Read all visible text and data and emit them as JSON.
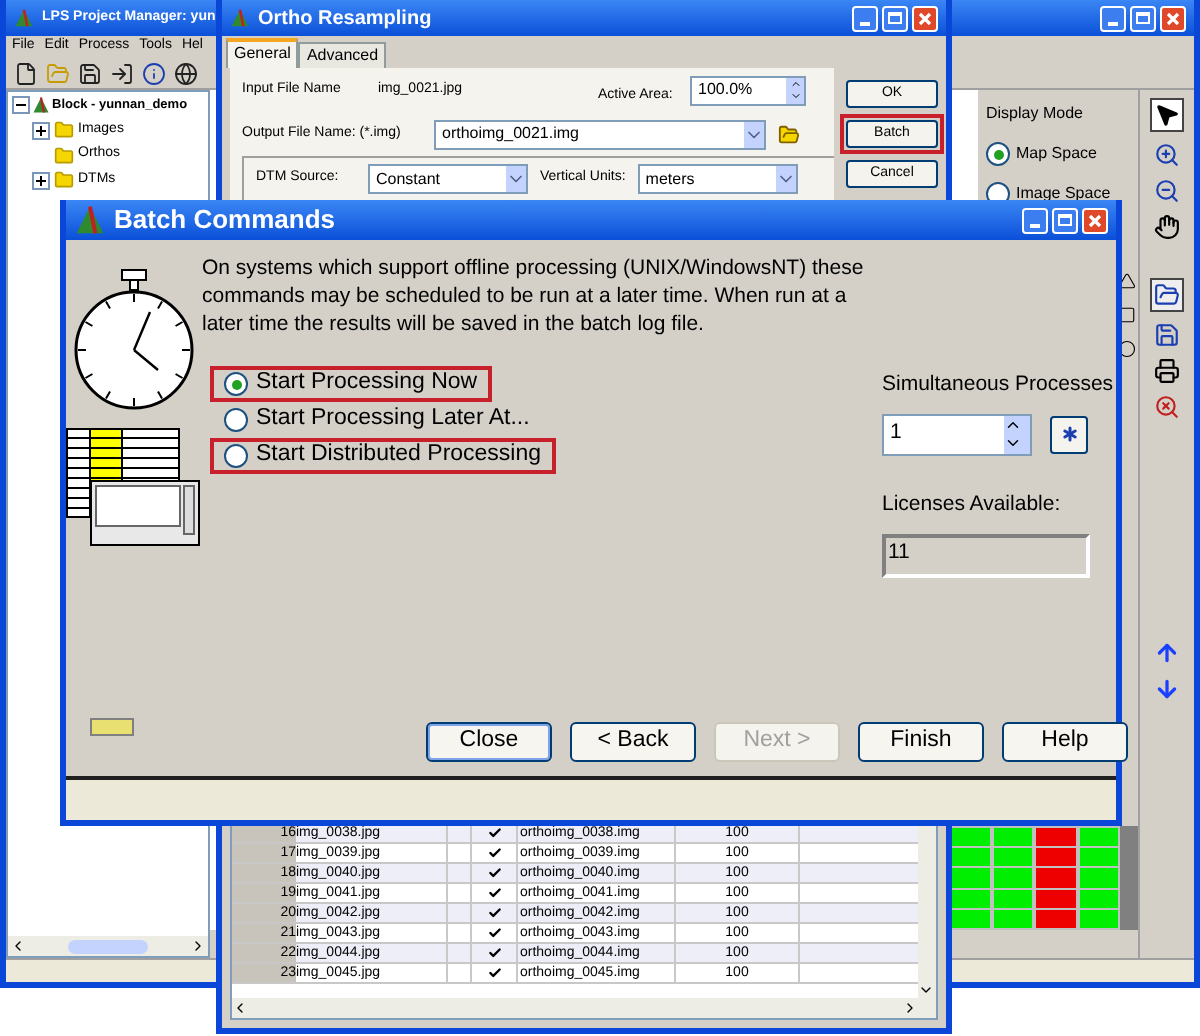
{
  "project_window": {
    "title": "LPS Project Manager: yun",
    "menu": [
      "File",
      "Edit",
      "Process",
      "Tools",
      "Hel"
    ],
    "tree": {
      "label": "Block - yunnan_demo",
      "expanded": true,
      "children": [
        {
          "label": "Images",
          "expanded": false
        },
        {
          "label": "Orthos"
        },
        {
          "label": "DTMs",
          "expanded": false
        }
      ]
    },
    "display_mode": {
      "title": "Display Mode",
      "options": [
        {
          "label": "Map Space",
          "selected": true
        },
        {
          "label": "Image Space",
          "selected": false
        }
      ]
    },
    "status_grid": {
      "columns": [
        {
          "color": "#00ee00"
        },
        {
          "color": "#00ee00"
        },
        {
          "color": "#ee0000"
        },
        {
          "color": "#00ee00"
        }
      ]
    }
  },
  "ortho_window": {
    "title": "Ortho Resampling",
    "tabs": [
      {
        "label": "General",
        "selected": true
      },
      {
        "label": "Advanced",
        "selected": false
      }
    ],
    "input_file": {
      "label": "Input File Name",
      "value": "img_0021.jpg"
    },
    "active_area": {
      "label": "Active Area:",
      "value": "100.0%"
    },
    "output_file": {
      "label": "Output File Name: (*.img)",
      "value": "orthoimg_0021.img"
    },
    "dtm_source": {
      "label": "DTM Source:",
      "value": "Constant"
    },
    "vertical_units": {
      "label": "Vertical Units:",
      "value": "meters"
    },
    "buttons": [
      {
        "label": "OK",
        "highlighted": false
      },
      {
        "label": "Batch",
        "highlighted": true
      },
      {
        "label": "Cancel",
        "highlighted": false
      }
    ],
    "table": {
      "rows": [
        {
          "number": "16",
          "input": "img_0038.jpg",
          "checked": true,
          "output": "orthoimg_0038.img",
          "value": "100"
        },
        {
          "number": "17",
          "input": "img_0039.jpg",
          "checked": true,
          "output": "orthoimg_0039.img",
          "value": "100"
        },
        {
          "number": "18",
          "input": "img_0040.jpg",
          "checked": true,
          "output": "orthoimg_0040.img",
          "value": "100"
        },
        {
          "number": "19",
          "input": "img_0041.jpg",
          "checked": true,
          "output": "orthoimg_0041.img",
          "value": "100"
        },
        {
          "number": "20",
          "input": "img_0042.jpg",
          "checked": true,
          "output": "orthoimg_0042.img",
          "value": "100"
        },
        {
          "number": "21",
          "input": "img_0043.jpg",
          "checked": true,
          "output": "orthoimg_0043.img",
          "value": "100"
        },
        {
          "number": "22",
          "input": "img_0044.jpg",
          "checked": true,
          "output": "orthoimg_0044.img",
          "value": "100"
        },
        {
          "number": "23",
          "input": "img_0045.jpg",
          "checked": true,
          "output": "orthoimg_0045.img",
          "value": "100"
        }
      ]
    }
  },
  "batch_dialog": {
    "title": "Batch Commands",
    "description": "On systems which support offline processing (UNIX/WindowsNT) these commands may be scheduled to be run at a later time. When run at a later time the results will be saved in the batch log file.",
    "options": [
      {
        "label": "Start Processing Now",
        "selected": true,
        "highlighted": true
      },
      {
        "label": "Start Processing Later At...",
        "selected": false,
        "highlighted": false
      },
      {
        "label": "Start Distributed Processing",
        "selected": false,
        "highlighted": true
      }
    ],
    "simultaneous": {
      "label": "Simultaneous Processes",
      "value": "1"
    },
    "licenses": {
      "label": "Licenses Available:",
      "value": "11"
    },
    "buttons": [
      {
        "label": "Close",
        "disabled": false,
        "default": true
      },
      {
        "label": "< Back",
        "disabled": false,
        "default": false
      },
      {
        "label": "Next >",
        "disabled": true,
        "default": false
      },
      {
        "label": "Finish",
        "disabled": false,
        "default": false
      },
      {
        "label": "Help",
        "disabled": false,
        "default": false
      }
    ]
  }
}
